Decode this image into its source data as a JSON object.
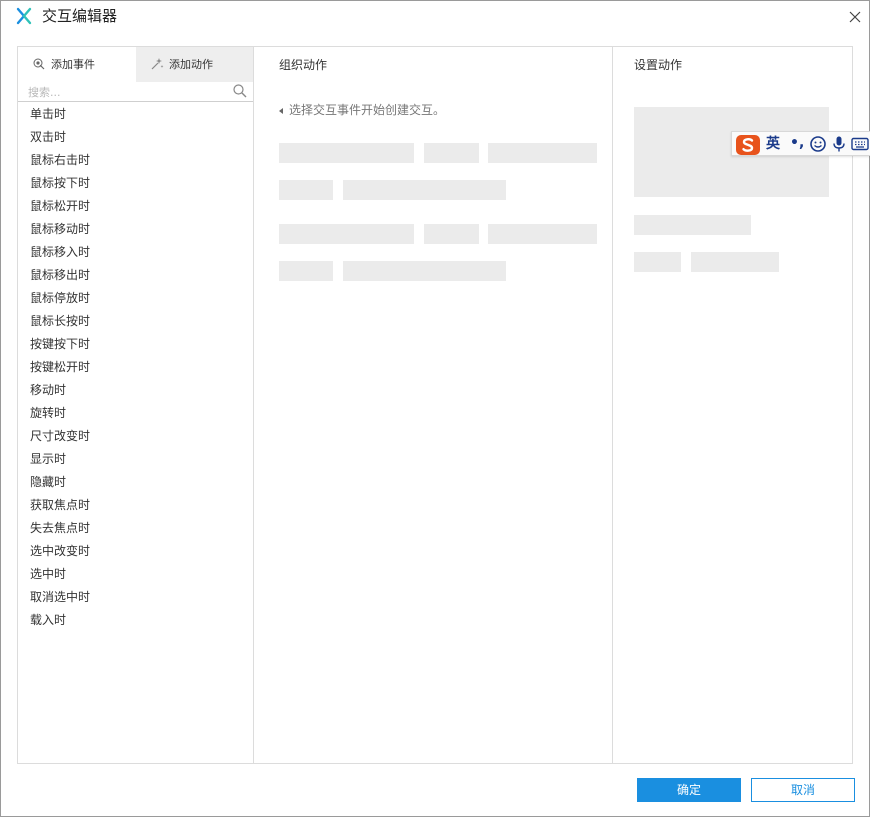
{
  "window": {
    "title": "交互编辑器"
  },
  "tabs": [
    {
      "label": "添加事件",
      "icon": "add-event-icon"
    },
    {
      "label": "添加动作",
      "icon": "add-action-icon"
    }
  ],
  "search": {
    "placeholder": "搜索..."
  },
  "events": [
    "单击时",
    "双击时",
    "鼠标右击时",
    "鼠标按下时",
    "鼠标松开时",
    "鼠标移动时",
    "鼠标移入时",
    "鼠标移出时",
    "鼠标停放时",
    "鼠标长按时",
    "按键按下时",
    "按键松开时",
    "移动时",
    "旋转时",
    "尺寸改变时",
    "显示时",
    "隐藏时",
    "获取焦点时",
    "失去焦点时",
    "选中改变时",
    "选中时",
    "取消选中时",
    "载入时"
  ],
  "middle": {
    "heading": "组织动作",
    "hint": "选择交互事件开始创建交互。"
  },
  "right": {
    "heading": "设置动作"
  },
  "buttons": {
    "ok": "确定",
    "cancel": "取消"
  },
  "ime": {
    "lang": "英",
    "punct": "•,",
    "icons": [
      "sogou-logo-icon",
      "emoji-icon",
      "microphone-icon",
      "keyboard-icon"
    ]
  },
  "colors": {
    "accent": "#1a8fe0",
    "placeholder": "#ebebeb",
    "tab_inactive": "#eeeeee",
    "ime_logo": "#e8531c"
  }
}
